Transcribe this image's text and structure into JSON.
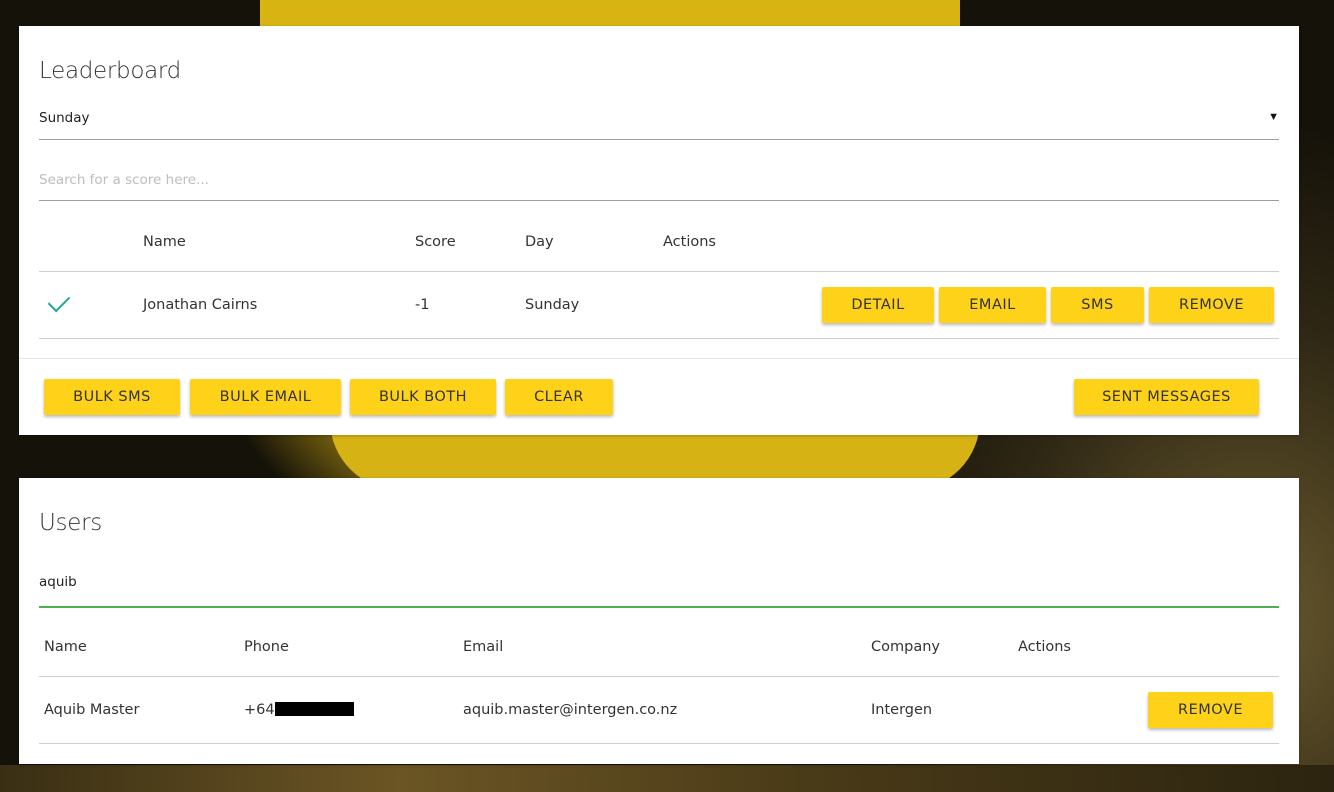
{
  "leaderboard": {
    "title": "Leaderboard",
    "day_select": {
      "selected": "Sunday",
      "caret": "▼"
    },
    "search": {
      "placeholder": "Search for a score here...",
      "value": ""
    },
    "columns": [
      "Name",
      "Score",
      "Day",
      "Actions"
    ],
    "rows": [
      {
        "checked": true,
        "name": "Jonathan Cairns",
        "score": "-1",
        "day": "Sunday",
        "actions": [
          "DETAIL",
          "EMAIL",
          "SMS",
          "REMOVE"
        ]
      }
    ],
    "footer_buttons": [
      "BULK SMS",
      "BULK EMAIL",
      "BULK BOTH",
      "CLEAR"
    ],
    "sent_messages_label": "SENT MESSAGES"
  },
  "users": {
    "title": "Users",
    "search": {
      "value": "aquib"
    },
    "columns": [
      "Name",
      "Phone",
      "Email",
      "Company",
      "Actions"
    ],
    "rows": [
      {
        "name": "Aquib Master",
        "phone_prefix": "+64",
        "email": "aquib.master@intergen.co.nz",
        "company": "Intergen",
        "action": "REMOVE"
      }
    ]
  },
  "colors": {
    "accent_button": "#ffd21a",
    "check": "#26a69a",
    "focus_underline": "#4caf50"
  },
  "icons": {
    "row_selected": "check-icon",
    "select_caret": "caret-down-icon"
  }
}
